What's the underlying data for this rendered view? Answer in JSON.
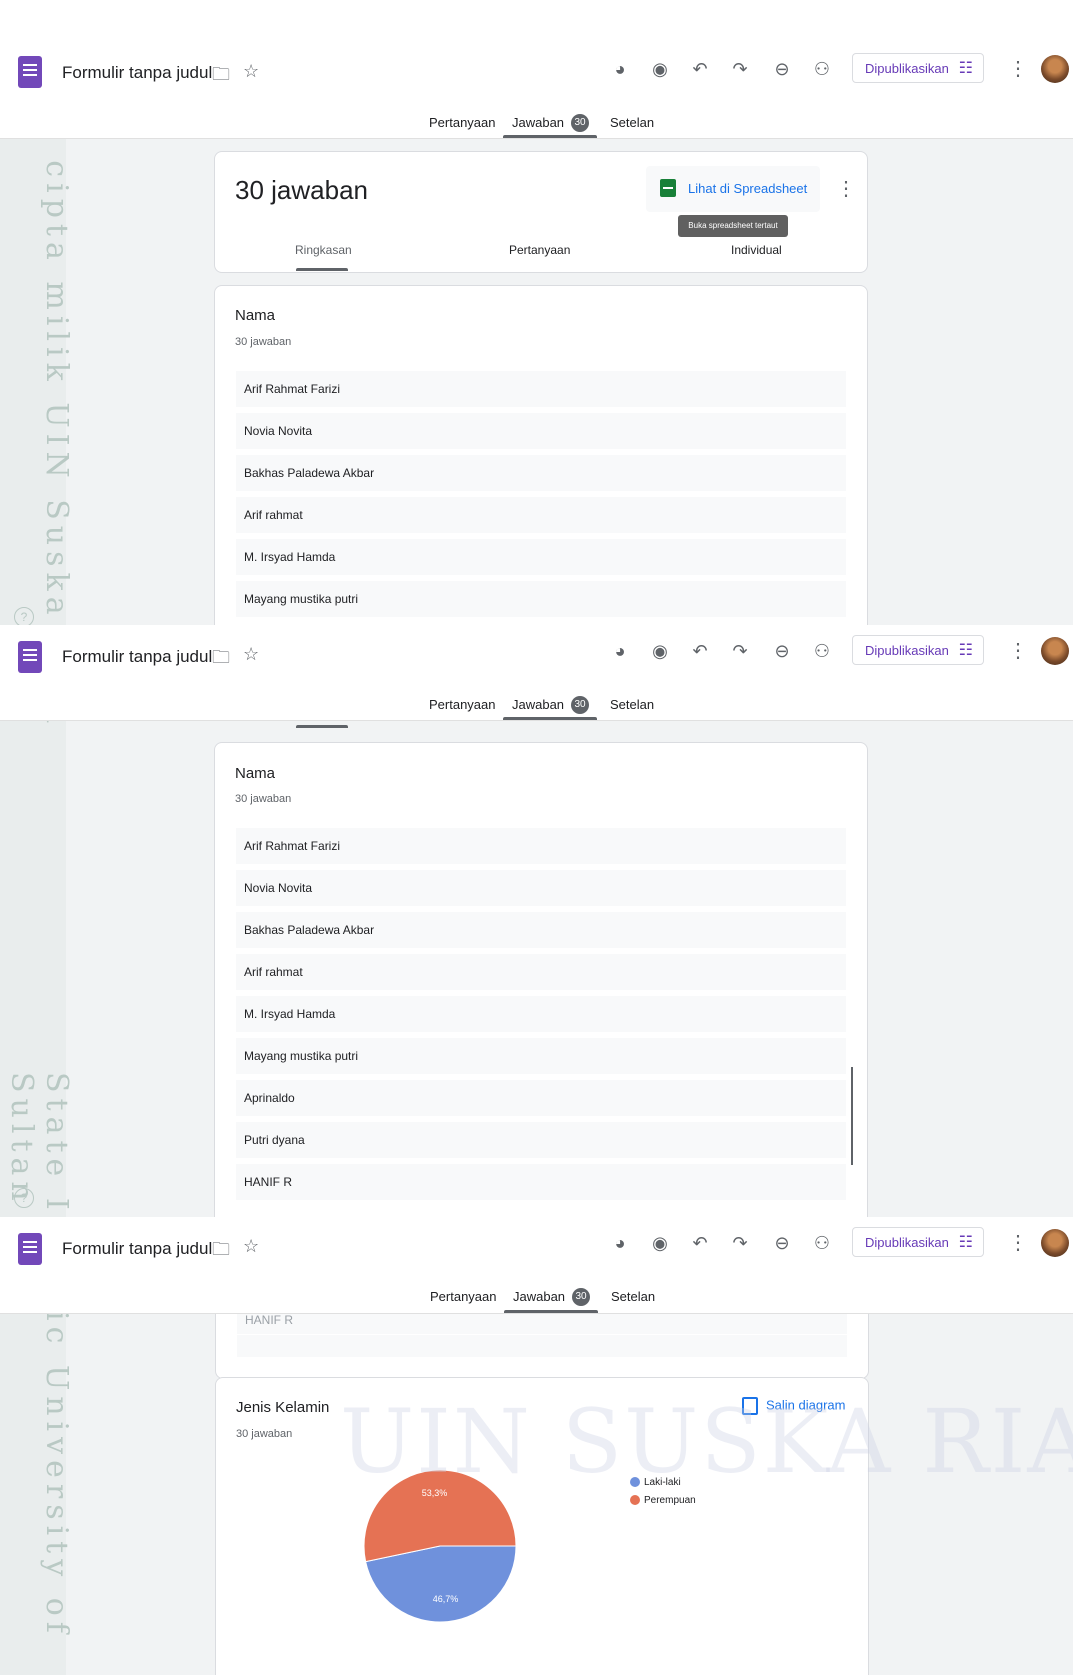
{
  "form": {
    "title": "Formulir tanpa judul",
    "publish_label": "Dipublikasikan"
  },
  "tabs": {
    "questions": "Pertanyaan",
    "responses": "Jawaban",
    "responses_count": "30",
    "settings": "Setelan"
  },
  "summary": {
    "count_label": "30 jawaban",
    "sheet_button_label": "Lihat di Spreadsheet",
    "sheet_tooltip": "Buka spreadsheet tertaut",
    "subtabs": {
      "summary": "Ringkasan",
      "questions": "Pertanyaan",
      "individual": "Individual"
    }
  },
  "name_question": {
    "title": "Nama",
    "subtitle": "30 jawaban",
    "answers": [
      "Arif Rahmat Farizi",
      "Novia Novita",
      "Bakhas Paladewa Akbar",
      "Arif rahmat",
      "M. Irsyad Hamda",
      "Mayang mustika putri",
      "Aprinaldo",
      "Putri dyana",
      "HANIF R"
    ],
    "partial_row": "HANIF R"
  },
  "gender_question": {
    "title": "Jenis Kelamin",
    "subtitle": "30 jawaban",
    "copy_label": "Salin diagram"
  },
  "chart_data": {
    "type": "pie",
    "labels": [
      "Laki-laki",
      "Perempuan"
    ],
    "values": [
      46.7,
      53.3
    ],
    "data_labels": [
      "46,7%",
      "53,3%"
    ],
    "colors": [
      "#6f91dc",
      "#e57254"
    ],
    "legend_position": "right"
  },
  "watermark": {
    "vertical_top": "© Hak cipta milik UIN Suska Riau",
    "vertical_bottom": "State Islamic University of Sultan S",
    "big_text": "UIN SUSKA RIAU"
  },
  "colors": {
    "accent": "#673ab7",
    "link": "#1a73e8",
    "sheets_green": "#188038",
    "badge": "#5f6368"
  }
}
